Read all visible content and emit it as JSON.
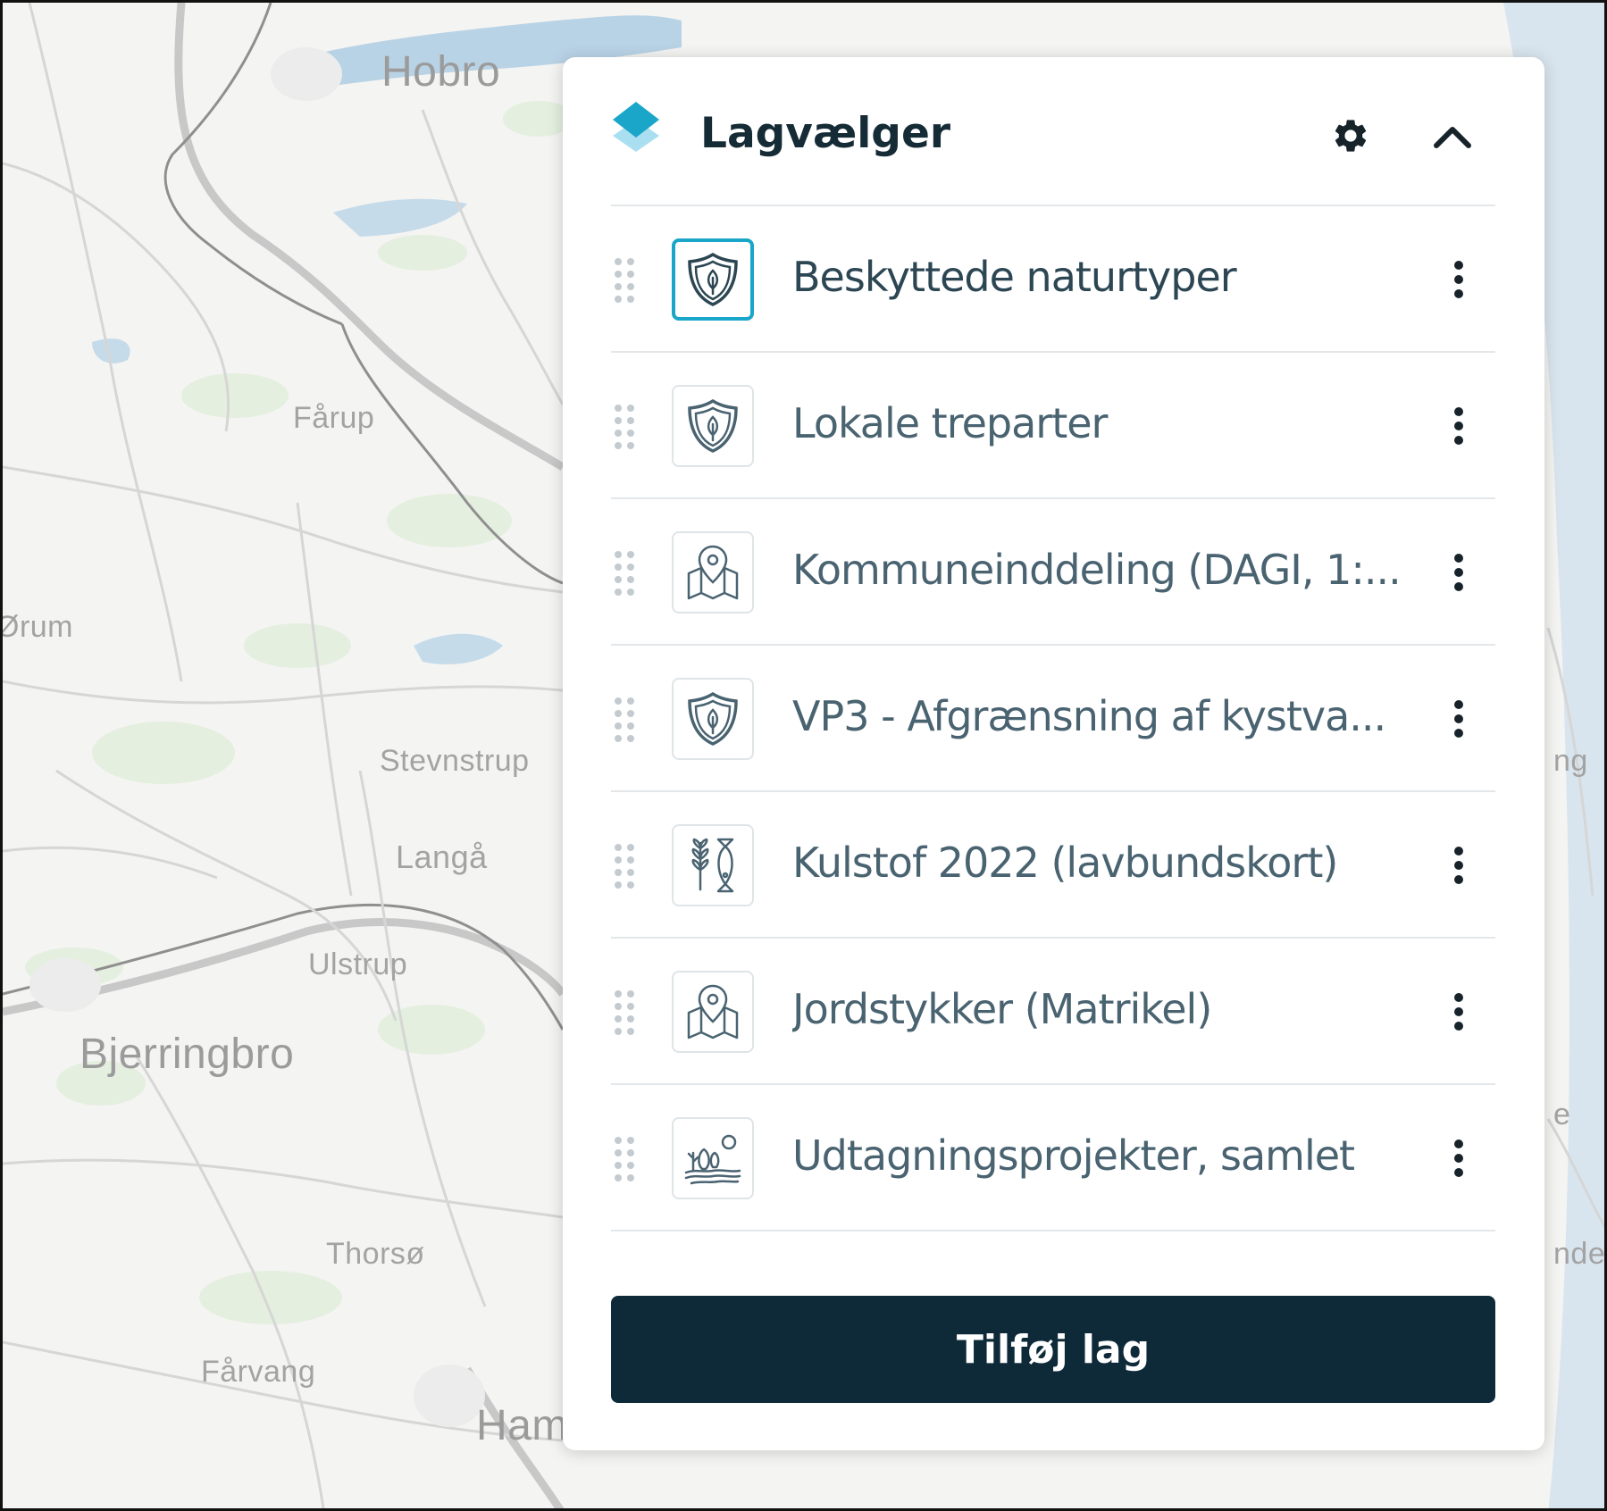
{
  "map": {
    "places": [
      {
        "name": "Hobro"
      },
      {
        "name": "Fårup"
      },
      {
        "name": "Ørum"
      },
      {
        "name": "Stevnstrup"
      },
      {
        "name": "Langå"
      },
      {
        "name": "Ulstrup"
      },
      {
        "name": "Bjerringbro"
      },
      {
        "name": "Thorsø"
      },
      {
        "name": "Fårvang"
      },
      {
        "name": "Ham"
      },
      {
        "name": "ng"
      },
      {
        "name": "nde"
      },
      {
        "name": "e"
      }
    ]
  },
  "panel": {
    "title": "Lagvælger",
    "settings_icon": "gear-icon",
    "collapse_icon": "chevron-up-icon",
    "layers": [
      {
        "label": "Beskyttede naturtyper",
        "icon": "shield-leaf-icon",
        "active": true
      },
      {
        "label": "Lokale treparter",
        "icon": "shield-leaf-icon",
        "active": false
      },
      {
        "label": "Kommuneinddeling (DAGI, 1:...",
        "icon": "map-pin-icon",
        "active": false
      },
      {
        "label": "VP3 - Afgrænsning af kystva...",
        "icon": "shield-leaf-icon",
        "active": false
      },
      {
        "label": "Kulstof 2022 (lavbundskort)",
        "icon": "wheat-fish-icon",
        "active": false
      },
      {
        "label": "Jordstykker (Matrikel)",
        "icon": "map-pin-icon",
        "active": false
      },
      {
        "label": "Udtagningsprojekter, samlet",
        "icon": "landscape-icon",
        "active": false
      }
    ],
    "add_button_label": "Tilføj lag"
  },
  "colors": {
    "accent": "#1aa6c9",
    "button_bg": "#0e2a38",
    "icon_stroke": "#4a6371"
  }
}
